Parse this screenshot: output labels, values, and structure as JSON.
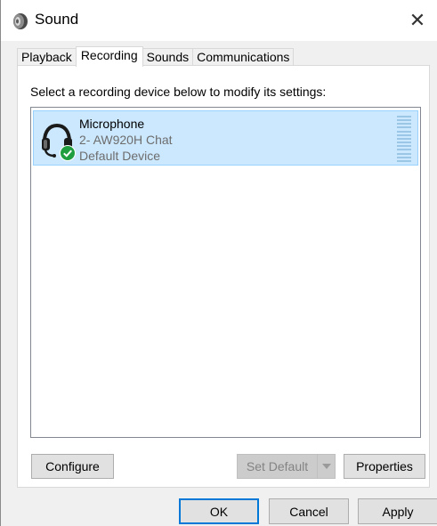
{
  "window": {
    "title": "Sound",
    "close_glyph": "✕",
    "icon": "speaker-icon"
  },
  "tabs": [
    {
      "label": "Playback",
      "active": false
    },
    {
      "label": "Recording",
      "active": true
    },
    {
      "label": "Sounds",
      "active": false
    },
    {
      "label": "Communications",
      "active": false
    }
  ],
  "panel": {
    "instruction": "Select a recording device below to modify its settings:",
    "devices": [
      {
        "name": "Microphone",
        "description": "2- AW920H Chat",
        "status": "Default Device",
        "selected": true,
        "icon": "headset-microphone-icon",
        "status_icon": "green-check-icon",
        "level": 0
      }
    ],
    "buttons": {
      "configure": "Configure",
      "set_default": "Set Default",
      "properties": "Properties"
    }
  },
  "footer": {
    "ok": "OK",
    "cancel": "Cancel",
    "apply": "Apply"
  },
  "colors": {
    "selection_bg": "#cce8ff",
    "selection_border": "#99d1ff",
    "accent": "#0078d7",
    "check_green": "#1e9e3e"
  }
}
